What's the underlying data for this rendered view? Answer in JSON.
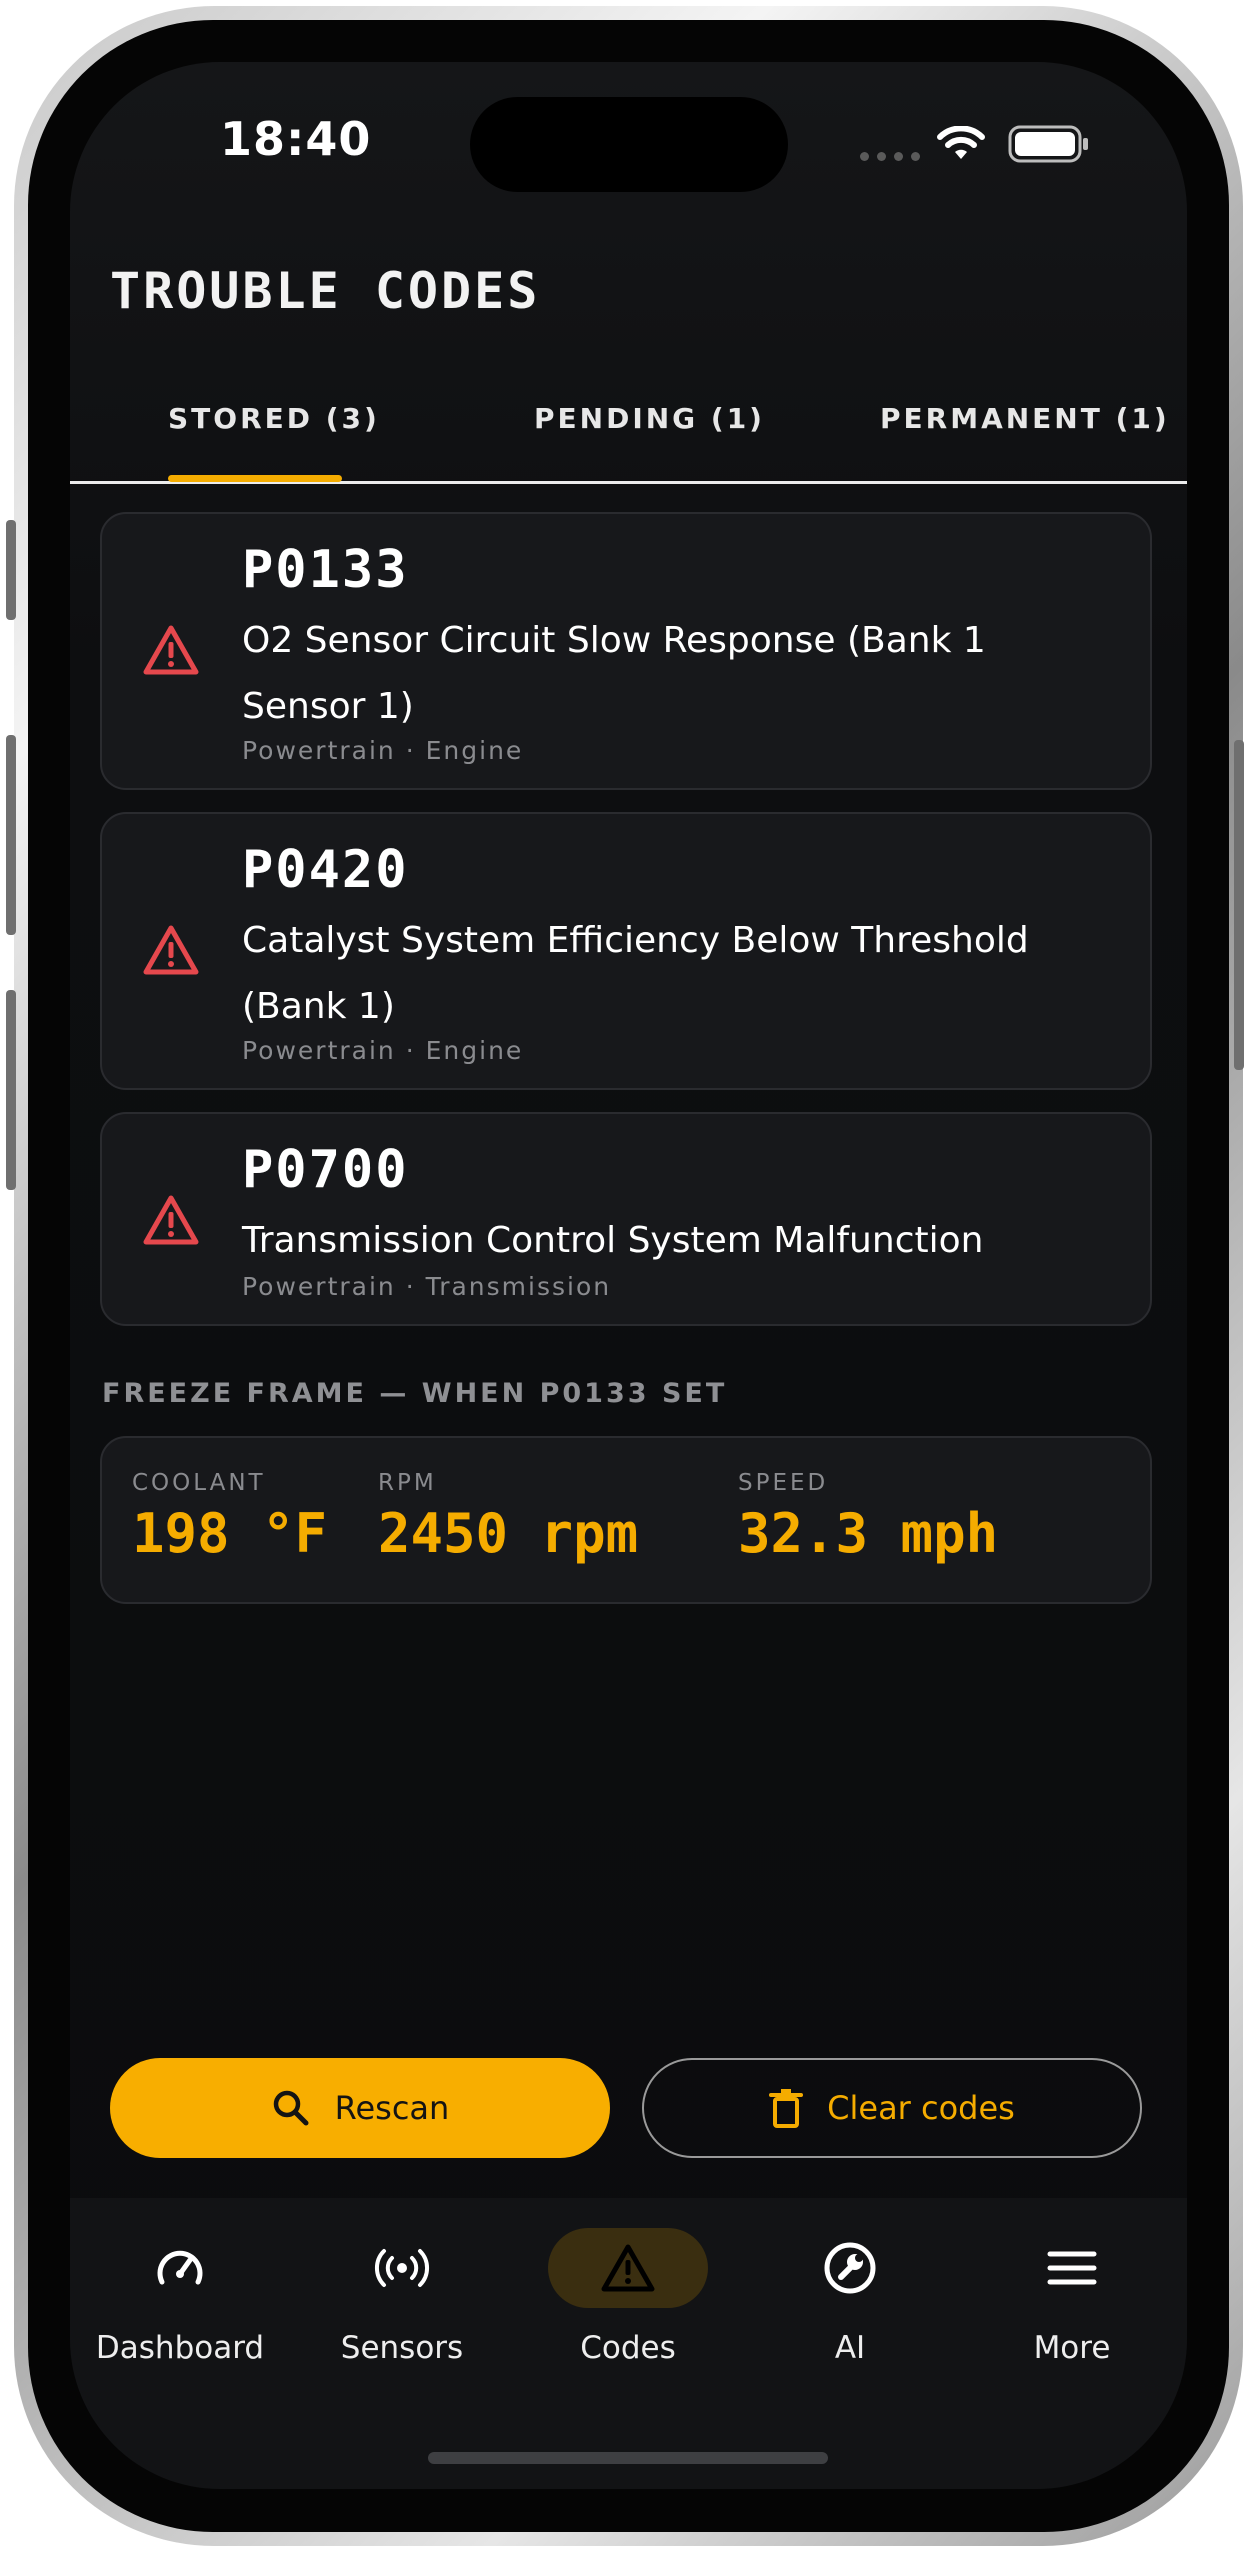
{
  "status_bar": {
    "time": "18:40"
  },
  "header": {
    "title": "TROUBLE CODES"
  },
  "tabs": [
    {
      "label": "STORED (3)",
      "active": true
    },
    {
      "label": "PENDING (1)",
      "active": false
    },
    {
      "label": "PERMANENT (1)",
      "active": false
    }
  ],
  "codes": [
    {
      "code": "P0133",
      "description": "O2 Sensor Circuit Slow Response (Bank 1 Sensor 1)",
      "meta": "Powertrain · Engine"
    },
    {
      "code": "P0420",
      "description": "Catalyst System Efficiency Below Threshold (Bank 1)",
      "meta": "Powertrain · Engine"
    },
    {
      "code": "P0700",
      "description": "Transmission Control System Malfunction",
      "meta": "Powertrain · Transmission"
    }
  ],
  "freeze_frame": {
    "label": "FREEZE FRAME — WHEN P0133 SET",
    "items": [
      {
        "label": "COOLANT",
        "value": "198 °F"
      },
      {
        "label": "RPM",
        "value": "2450 rpm"
      },
      {
        "label": "SPEED",
        "value": "32.3 mph"
      }
    ]
  },
  "actions": {
    "rescan_label": "Rescan",
    "clear_label": "Clear codes"
  },
  "nav": [
    {
      "label": "Dashboard",
      "icon": "gauge-icon",
      "active": false
    },
    {
      "label": "Sensors",
      "icon": "broadcast-icon",
      "active": false
    },
    {
      "label": "Codes",
      "icon": "warning-icon",
      "active": true
    },
    {
      "label": "AI",
      "icon": "wrench-icon",
      "active": false
    },
    {
      "label": "More",
      "icon": "menu-icon",
      "active": false
    }
  ],
  "colors": {
    "accent": "#f5ac00",
    "warning": "#e5484d",
    "background": "#0d0e10",
    "card": "#17181b"
  }
}
